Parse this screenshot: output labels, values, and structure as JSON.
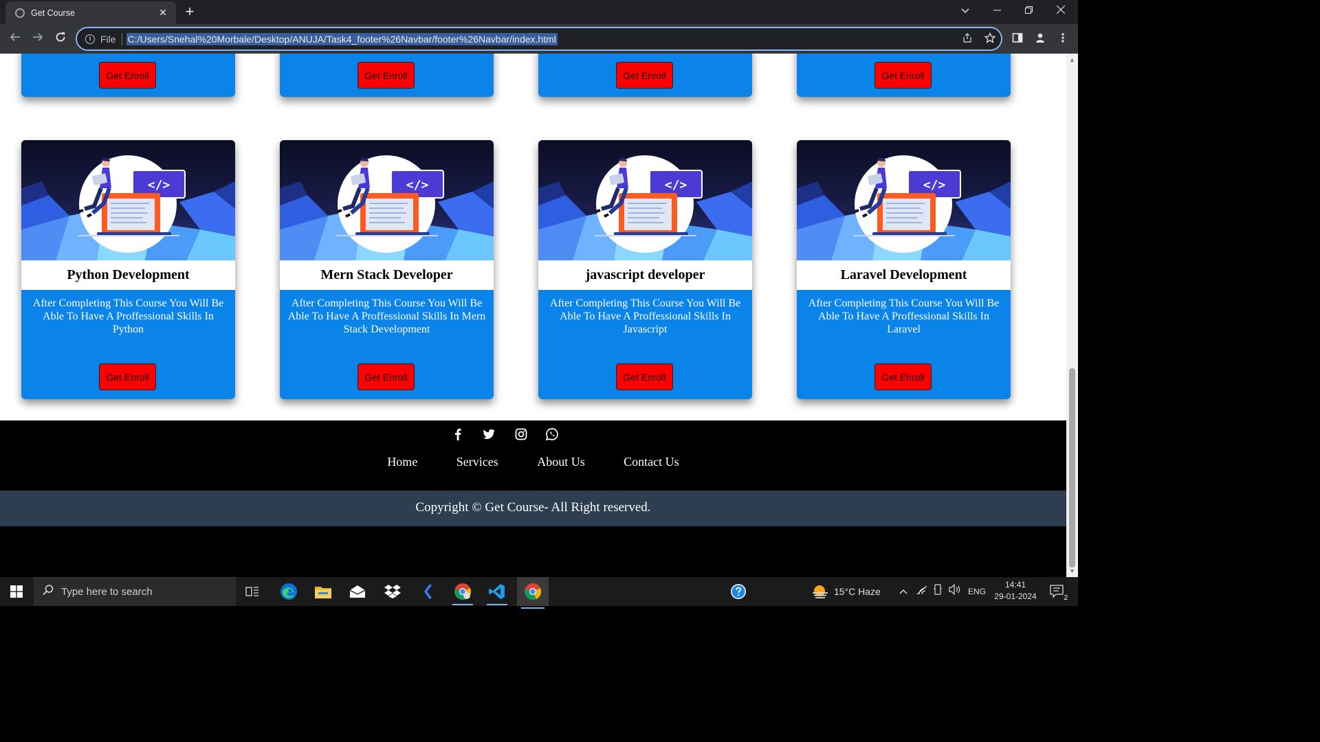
{
  "browser": {
    "tab_title": "Get Course",
    "tab_close": "✕",
    "new_tab": "+",
    "scheme_label": "File",
    "url": "C:/Users/Snehal%20Morbale/Desktop/ANUJA/Task4_footer%26Navbar/footer%26Navbar/index.html"
  },
  "top_row": {
    "button_label": "Get Enroll",
    "count": 4
  },
  "courses": [
    {
      "title": "Python Development",
      "description": "After Completing This Course You Will Be Able To Have A Proffessional Skills In Python",
      "button": "Get Enroll"
    },
    {
      "title": "Mern Stack Developer",
      "description": "After Completing This Course You Will Be Able To Have A Proffessional Skills In Mern Stack Development",
      "button": "Get Enroll"
    },
    {
      "title": "javascript developer",
      "description": "After Completing This Course You Will Be Able To Have A Proffessional Skills In Javascript",
      "button": "Get Enroll"
    },
    {
      "title": "Laravel Development",
      "description": "After Completing This Course You Will Be Able To Have A Proffessional Skills In Laravel",
      "button": "Get Enroll"
    }
  ],
  "card_image_code_tag": "</>",
  "footer": {
    "social_icons": [
      "facebook-icon",
      "twitter-icon",
      "instagram-icon",
      "whatsapp-icon"
    ],
    "links": [
      "Home",
      "Services",
      "About Us",
      "Contact Us"
    ],
    "copyright": "Copyright © Get Course- All Right reserved."
  },
  "taskbar": {
    "search_placeholder": "Type here to search",
    "weather": "15°C  Haze",
    "language": "ENG",
    "time": "14:41",
    "date": "29-01-2024",
    "notification_count": "2"
  },
  "colors": {
    "card_blue": "#0a84e8",
    "button_red": "#ff0000",
    "copyright_bar": "#2c3e50",
    "omnibox_focus": "#8ab4f8"
  }
}
